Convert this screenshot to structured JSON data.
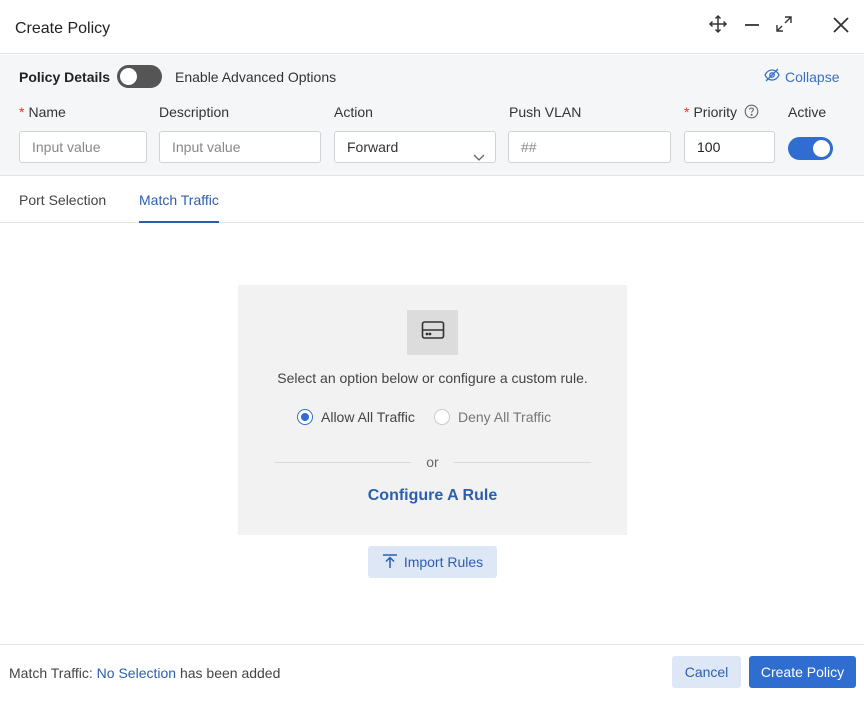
{
  "header": {
    "title": "Create Policy"
  },
  "details": {
    "label": "Policy Details",
    "advanced_label": "Enable Advanced Options",
    "advanced_enabled": false,
    "collapse_label": "Collapse",
    "fields": {
      "name": {
        "label": "Name",
        "required": true,
        "placeholder": "Input value"
      },
      "description": {
        "label": "Description",
        "placeholder": "Input value"
      },
      "action": {
        "label": "Action",
        "value": "Forward"
      },
      "push_vlan": {
        "label": "Push VLAN",
        "placeholder": "##"
      },
      "priority": {
        "label": "Priority",
        "required": true,
        "value": "100"
      },
      "active": {
        "label": "Active",
        "enabled": true
      }
    }
  },
  "tabs": [
    {
      "label": "Port Selection",
      "active": false
    },
    {
      "label": "Match Traffic",
      "active": true
    }
  ],
  "match_card": {
    "prompt": "Select an option below or configure a custom rule.",
    "options": [
      {
        "label": "Allow All Traffic",
        "selected": true
      },
      {
        "label": "Deny All Traffic",
        "selected": false
      }
    ],
    "or_label": "or",
    "configure_label": "Configure A Rule"
  },
  "import_label": "Import Rules",
  "footer": {
    "prefix": "Match Traffic:",
    "highlight": "No Selection",
    "suffix": "has been added",
    "cancel_label": "Cancel",
    "create_label": "Create Policy"
  },
  "colors": {
    "primary": "#2f6ed0",
    "link": "#2b5fae",
    "required": "#e0392b"
  }
}
